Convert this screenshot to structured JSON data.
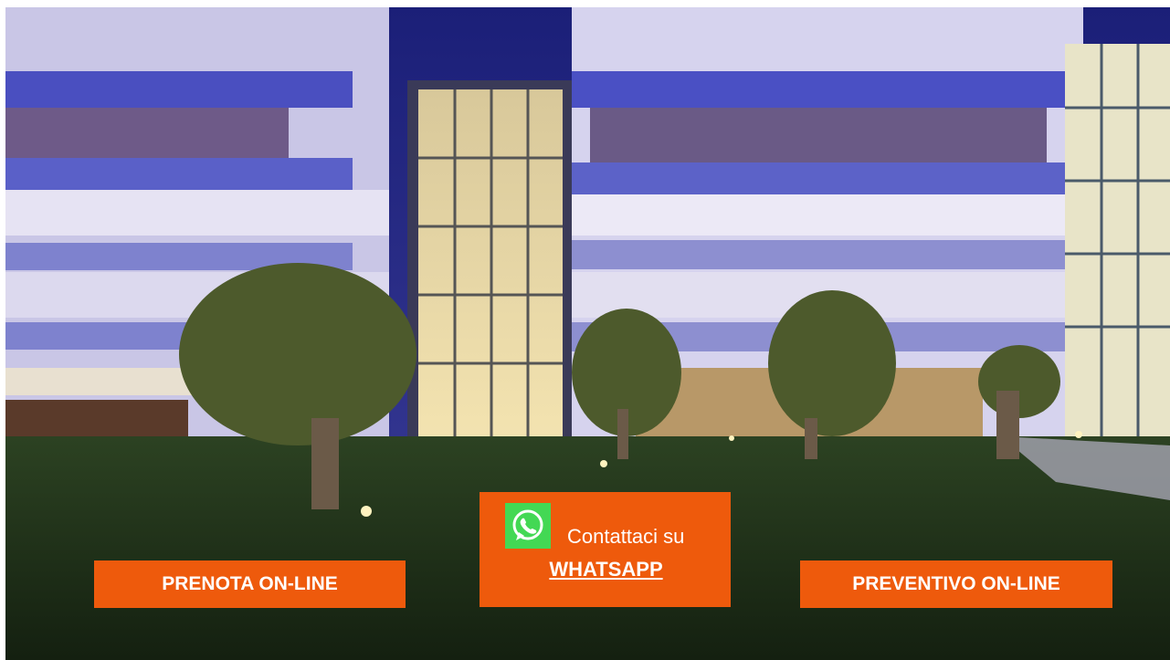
{
  "background": {
    "description_icon": "hotel-night-photo",
    "sky_color": "#2b2f8a",
    "lawn_color": "#1e2f16"
  },
  "buttons": {
    "prenota_label": "PRENOTA ON-LINE",
    "preventivo_label": "PREVENTIVO ON-LINE",
    "whatsapp_intro": "Contattaci su",
    "whatsapp_label": "WHATSAPP",
    "whatsapp_icon": "whatsapp-icon",
    "accent_color": "#ee5a0c",
    "whatsapp_icon_bg": "#43d854"
  }
}
